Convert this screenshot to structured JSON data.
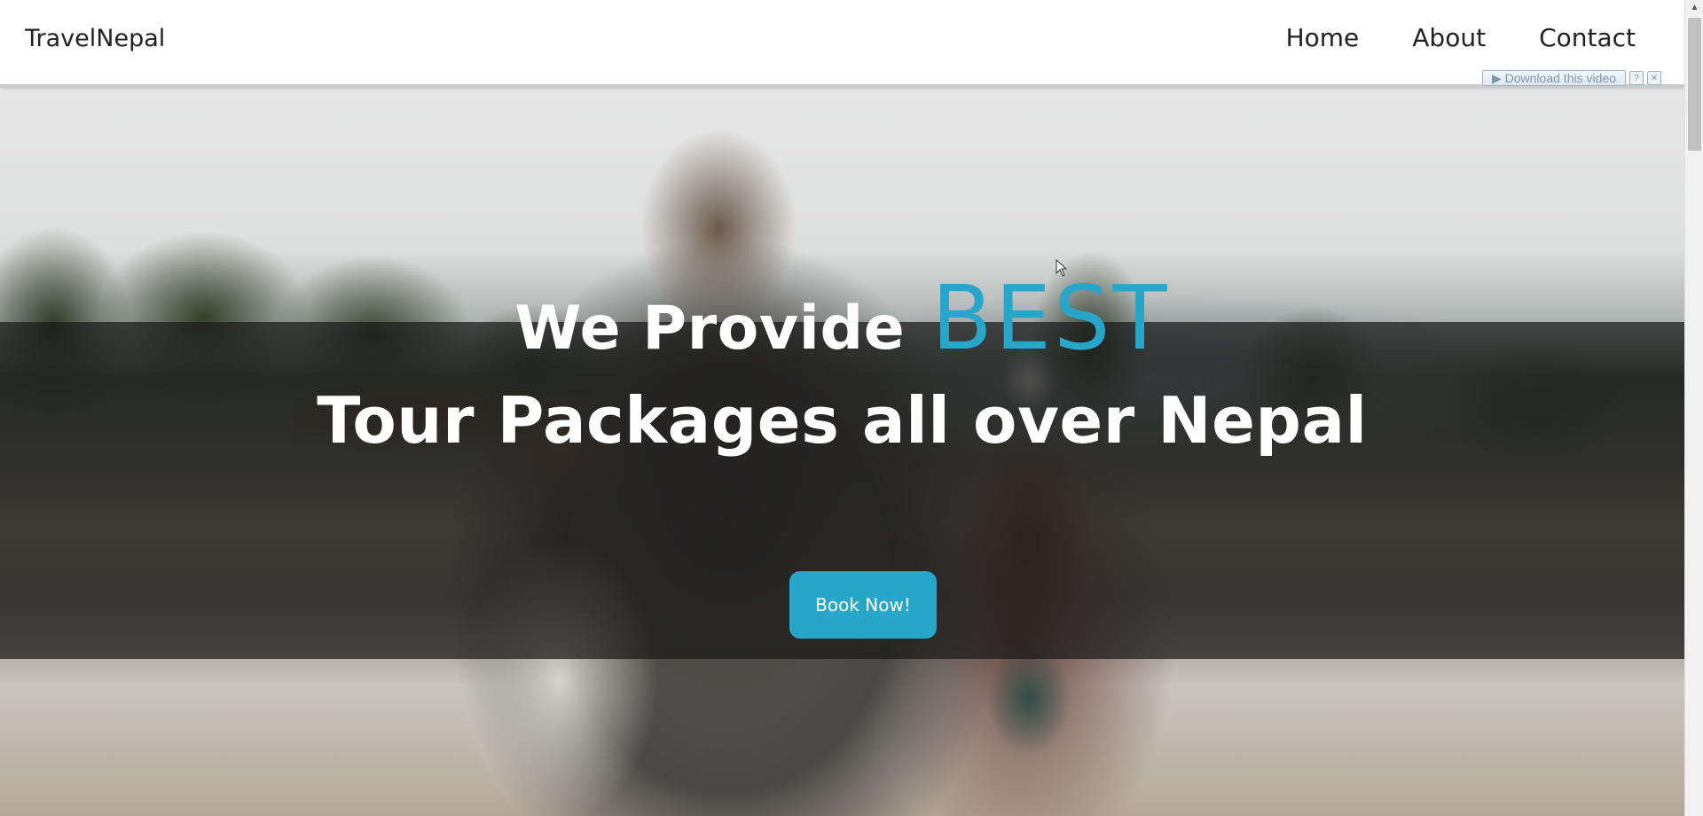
{
  "navbar": {
    "brand": "TravelNepal",
    "links": [
      "Home",
      "About",
      "Contact"
    ]
  },
  "plugin": {
    "download_label": "▶ Download this video",
    "help": "?",
    "close": "✕"
  },
  "hero": {
    "line1_prefix": "We Provide",
    "line1_accent": "BEST",
    "line2": "Tour Packages all over Nepal",
    "cta_label": "Book Now!"
  },
  "colors": {
    "accent": "#27a6c9",
    "overlay": "#191919"
  },
  "icons": {
    "scroll_up": "chevron-up-icon",
    "cursor": "mouse-pointer-icon"
  }
}
